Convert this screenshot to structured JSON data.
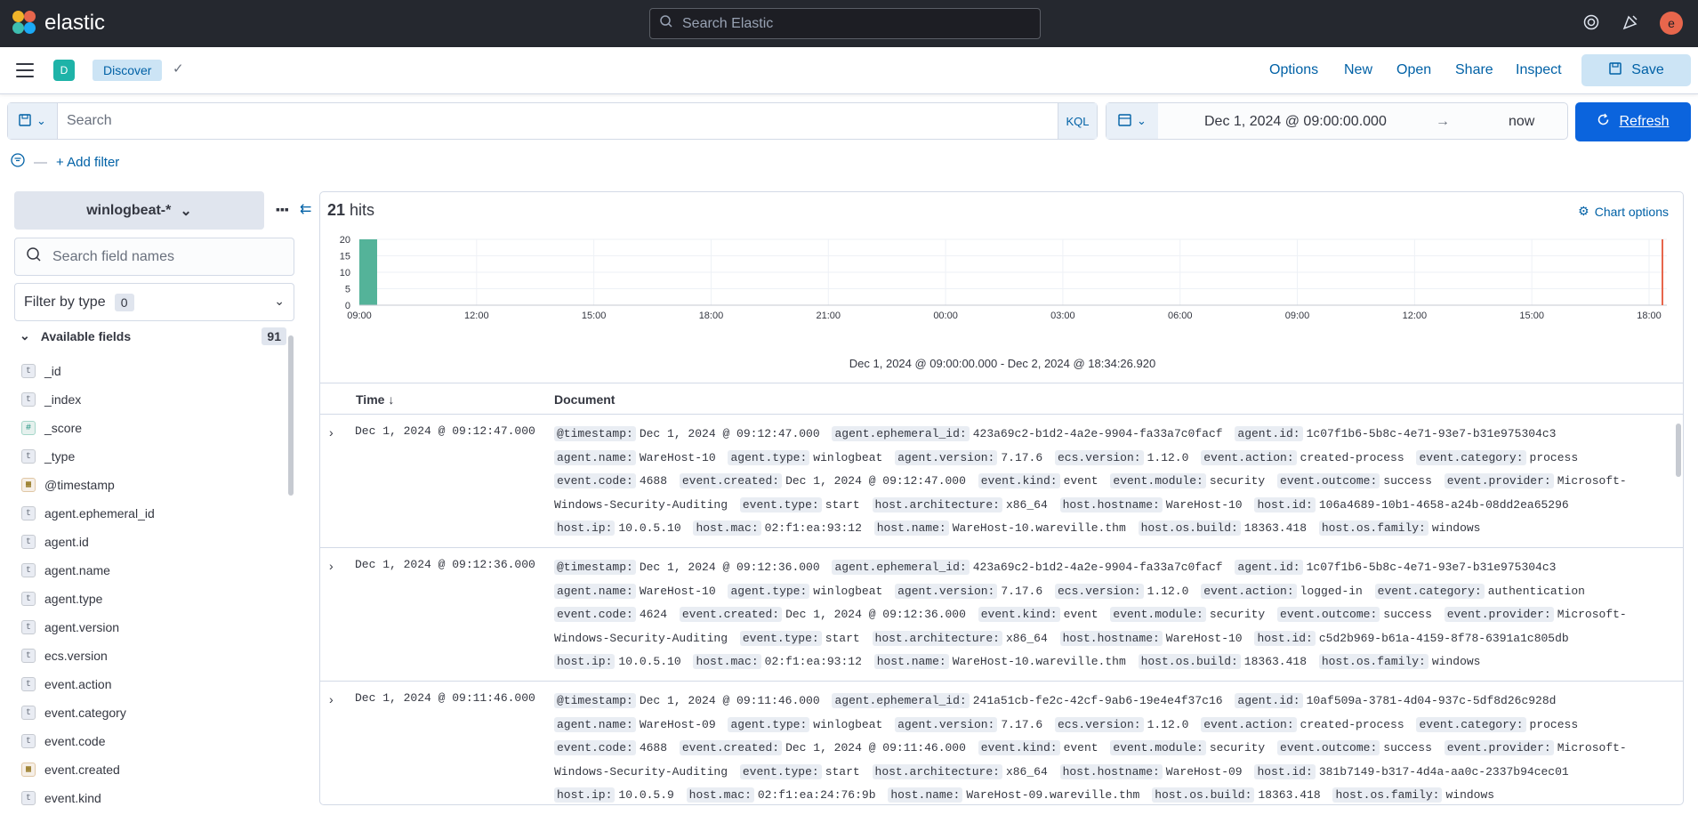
{
  "topbar": {
    "brand": "elastic",
    "search_placeholder": "Search Elastic",
    "user_initial": "e"
  },
  "appbar": {
    "space_initial": "D",
    "breadcrumb": "Discover",
    "links": [
      "Options",
      "New",
      "Open",
      "Share",
      "Inspect"
    ],
    "save_label": "Save"
  },
  "query": {
    "placeholder": "Search",
    "language": "KQL",
    "start": "Dec 1, 2024 @ 09:00:00.000",
    "arrow": "→",
    "end": "now",
    "refresh_label": "Refresh",
    "add_filter": "+ Add filter"
  },
  "sidebar": {
    "index_pattern": "winlogbeat-*",
    "search_placeholder": "Search field names",
    "filter_by_type": "Filter by type",
    "filter_count": "0",
    "available_label": "Available fields",
    "available_count": "91",
    "fields": [
      {
        "type": "t",
        "name": "_id"
      },
      {
        "type": "t",
        "name": "_index"
      },
      {
        "type": "#",
        "name": "_score"
      },
      {
        "type": "t",
        "name": "_type"
      },
      {
        "type": "date",
        "name": "@timestamp"
      },
      {
        "type": "t",
        "name": "agent.ephemeral_id"
      },
      {
        "type": "t",
        "name": "agent.id"
      },
      {
        "type": "t",
        "name": "agent.name"
      },
      {
        "type": "t",
        "name": "agent.type"
      },
      {
        "type": "t",
        "name": "agent.version"
      },
      {
        "type": "t",
        "name": "ecs.version"
      },
      {
        "type": "t",
        "name": "event.action"
      },
      {
        "type": "t",
        "name": "event.category"
      },
      {
        "type": "t",
        "name": "event.code"
      },
      {
        "type": "date",
        "name": "event.created"
      },
      {
        "type": "t",
        "name": "event.kind"
      }
    ]
  },
  "main": {
    "hits_count": "21",
    "hits_label": " hits",
    "chart_options": "Chart options",
    "range_caption": "Dec 1, 2024 @ 09:00:00.000 - Dec 2, 2024 @ 18:34:26.920",
    "col_time": "Time ↓",
    "col_document": "Document"
  },
  "chart_data": {
    "type": "bar",
    "y_ticks": [
      "20",
      "15",
      "10",
      "5",
      "0"
    ],
    "x_ticks": [
      "09:00",
      "12:00",
      "15:00",
      "18:00",
      "21:00",
      "00:00",
      "03:00",
      "06:00",
      "09:00",
      "12:00",
      "15:00",
      "18:00"
    ],
    "ylim": [
      0,
      20
    ],
    "bins": [
      {
        "x": "09:00",
        "value": 21
      }
    ],
    "bar_color": "#54b399",
    "now_marker_color": "#e7664c"
  },
  "rows": [
    {
      "time": "Dec 1, 2024 @ 09:12:47.000",
      "fields": [
        [
          "@timestamp:",
          "Dec 1, 2024 @ 09:12:47.000"
        ],
        [
          "agent.ephemeral_id:",
          "423a69c2-b1d2-4a2e-9904-fa33a7c0facf"
        ],
        [
          "agent.id:",
          "1c07f1b6-5b8c-4e71-93e7-b31e975304c3"
        ],
        [
          "agent.name:",
          "WareHost-10"
        ],
        [
          "agent.type:",
          "winlogbeat"
        ],
        [
          "agent.version:",
          "7.17.6"
        ],
        [
          "ecs.version:",
          "1.12.0"
        ],
        [
          "event.action:",
          "created-process"
        ],
        [
          "event.category:",
          "process"
        ],
        [
          "event.code:",
          "4688"
        ],
        [
          "event.created:",
          "Dec 1, 2024 @ 09:12:47.000"
        ],
        [
          "event.kind:",
          "event"
        ],
        [
          "event.module:",
          "security"
        ],
        [
          "event.outcome:",
          "success"
        ],
        [
          "event.provider:",
          "Microsoft-Windows-Security-Auditing"
        ],
        [
          "event.type:",
          "start"
        ],
        [
          "host.architecture:",
          "x86_64"
        ],
        [
          "host.hostname:",
          "WareHost-10"
        ],
        [
          "host.id:",
          "106a4689-10b1-4658-a24b-08dd2ea65296"
        ],
        [
          "host.ip:",
          "10.0.5.10"
        ],
        [
          "host.mac:",
          "02:f1:ea:93:12"
        ],
        [
          "host.name:",
          "WareHost-10.wareville.thm"
        ],
        [
          "host.os.build:",
          "18363.418"
        ],
        [
          "host.os.family:",
          "windows"
        ]
      ]
    },
    {
      "time": "Dec 1, 2024 @ 09:12:36.000",
      "fields": [
        [
          "@timestamp:",
          "Dec 1, 2024 @ 09:12:36.000"
        ],
        [
          "agent.ephemeral_id:",
          "423a69c2-b1d2-4a2e-9904-fa33a7c0facf"
        ],
        [
          "agent.id:",
          "1c07f1b6-5b8c-4e71-93e7-b31e975304c3"
        ],
        [
          "agent.name:",
          "WareHost-10"
        ],
        [
          "agent.type:",
          "winlogbeat"
        ],
        [
          "agent.version:",
          "7.17.6"
        ],
        [
          "ecs.version:",
          "1.12.0"
        ],
        [
          "event.action:",
          "logged-in"
        ],
        [
          "event.category:",
          "authentication"
        ],
        [
          "event.code:",
          "4624"
        ],
        [
          "event.created:",
          "Dec 1, 2024 @ 09:12:36.000"
        ],
        [
          "event.kind:",
          "event"
        ],
        [
          "event.module:",
          "security"
        ],
        [
          "event.outcome:",
          "success"
        ],
        [
          "event.provider:",
          "Microsoft-Windows-Security-Auditing"
        ],
        [
          "event.type:",
          "start"
        ],
        [
          "host.architecture:",
          "x86_64"
        ],
        [
          "host.hostname:",
          "WareHost-10"
        ],
        [
          "host.id:",
          "c5d2b969-b61a-4159-8f78-6391a1c805db"
        ],
        [
          "host.ip:",
          "10.0.5.10"
        ],
        [
          "host.mac:",
          "02:f1:ea:93:12"
        ],
        [
          "host.name:",
          "WareHost-10.wareville.thm"
        ],
        [
          "host.os.build:",
          "18363.418"
        ],
        [
          "host.os.family:",
          "windows"
        ]
      ]
    },
    {
      "time": "Dec 1, 2024 @ 09:11:46.000",
      "fields": [
        [
          "@timestamp:",
          "Dec 1, 2024 @ 09:11:46.000"
        ],
        [
          "agent.ephemeral_id:",
          "241a51cb-fe2c-42cf-9ab6-19e4e4f37c16"
        ],
        [
          "agent.id:",
          "10af509a-3781-4d04-937c-5df8d26c928d"
        ],
        [
          "agent.name:",
          "WareHost-09"
        ],
        [
          "agent.type:",
          "winlogbeat"
        ],
        [
          "agent.version:",
          "7.17.6"
        ],
        [
          "ecs.version:",
          "1.12.0"
        ],
        [
          "event.action:",
          "created-process"
        ],
        [
          "event.category:",
          "process"
        ],
        [
          "event.code:",
          "4688"
        ],
        [
          "event.created:",
          "Dec 1, 2024 @ 09:11:46.000"
        ],
        [
          "event.kind:",
          "event"
        ],
        [
          "event.module:",
          "security"
        ],
        [
          "event.outcome:",
          "success"
        ],
        [
          "event.provider:",
          "Microsoft-Windows-Security-Auditing"
        ],
        [
          "event.type:",
          "start"
        ],
        [
          "host.architecture:",
          "x86_64"
        ],
        [
          "host.hostname:",
          "WareHost-09"
        ],
        [
          "host.id:",
          "381b7149-b317-4d4a-aa0c-2337b94cec01"
        ],
        [
          "host.ip:",
          "10.0.5.9"
        ],
        [
          "host.mac:",
          "02:f1:ea:24:76:9b"
        ],
        [
          "host.name:",
          "WareHost-09.wareville.thm"
        ],
        [
          "host.os.build:",
          "18363.418"
        ],
        [
          "host.os.family:",
          "windows"
        ]
      ]
    }
  ]
}
